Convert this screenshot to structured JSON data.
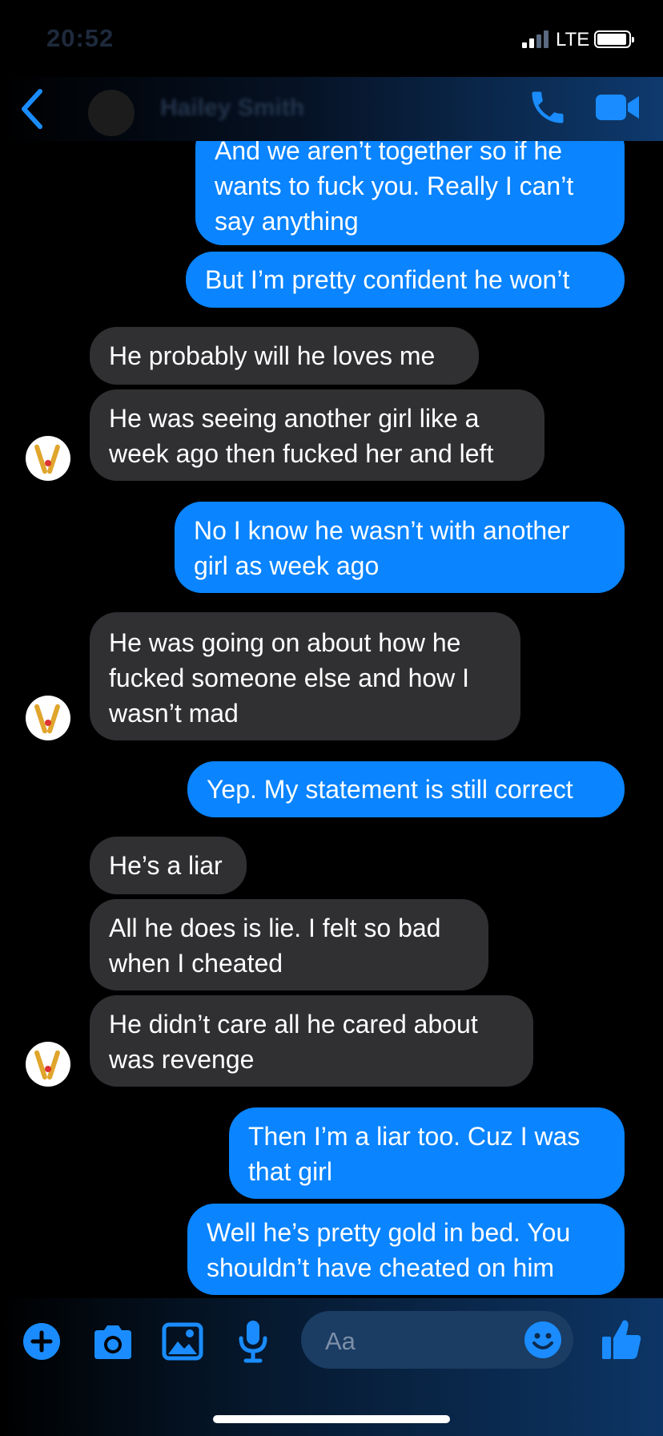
{
  "status": {
    "time": "20:52",
    "network": "LTE"
  },
  "header": {
    "contact_name": "Hailey Smith"
  },
  "messages": [
    {
      "side": "sent",
      "lines": [
        "And we aren’t together so if he",
        "wants to fuck you. Really I can’t",
        "say anything"
      ]
    },
    {
      "side": "sent",
      "lines": [
        "But I’m pretty confident he won’t"
      ]
    },
    {
      "side": "received",
      "lines": [
        "He probably will he loves me"
      ]
    },
    {
      "side": "received",
      "lines": [
        "He was seeing another girl like a",
        "week ago then fucked her and left"
      ]
    },
    {
      "side": "sent",
      "lines": [
        "No I know he wasn’t with another",
        "girl as week ago"
      ]
    },
    {
      "side": "received",
      "lines": [
        "He was going on about how he",
        "fucked someone else and how I",
        "wasn’t mad"
      ]
    },
    {
      "side": "sent",
      "lines": [
        "Yep. My statement is still correct"
      ]
    },
    {
      "side": "received",
      "lines": [
        "He’s a liar"
      ]
    },
    {
      "side": "received",
      "lines": [
        "All he does is lie. I felt so bad",
        "when I cheated"
      ]
    },
    {
      "side": "received",
      "lines": [
        "He didn’t care all he cared about",
        "was revenge"
      ]
    },
    {
      "side": "sent",
      "lines": [
        "Then I’m a liar too. Cuz I was",
        "that girl"
      ]
    },
    {
      "side": "sent",
      "lines": [
        "Well he’s pretty gold in bed. You",
        "shouldn’t have cheated on him"
      ]
    }
  ],
  "composer": {
    "placeholder": "Aa"
  },
  "colors": {
    "sent_bubble": "#0a84ff",
    "received_bubble": "#303033",
    "icon_blue": "#1a8cff",
    "background": "#000000"
  }
}
